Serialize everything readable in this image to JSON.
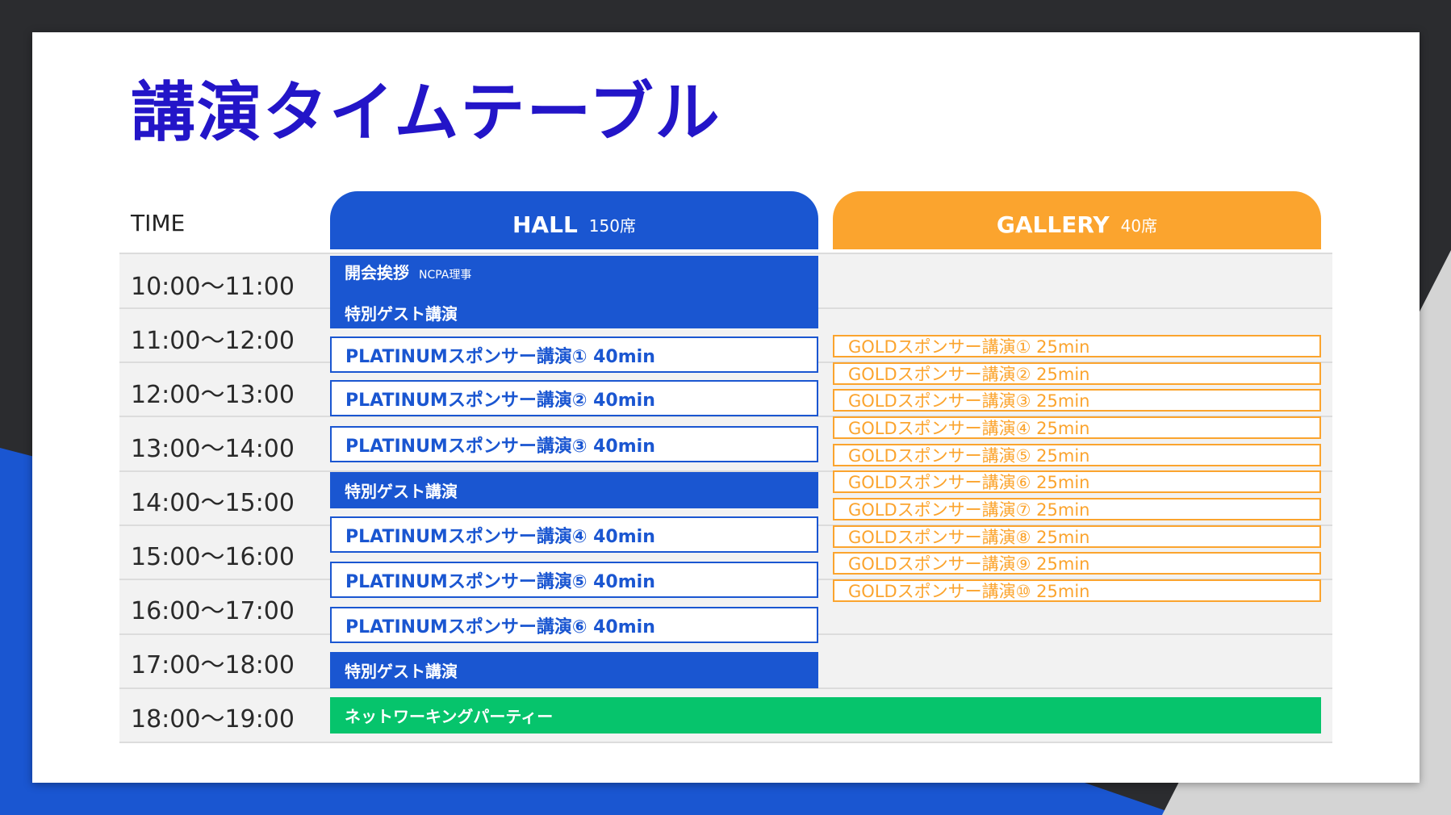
{
  "title": "講演タイムテーブル",
  "time_header": "TIME",
  "hall": {
    "name": "HALL",
    "seats": "150席"
  },
  "gallery": {
    "name": "GALLERY",
    "seats": "40席"
  },
  "time_slots": [
    "10:00〜11:00",
    "11:00〜12:00",
    "12:00〜13:00",
    "13:00〜14:00",
    "14:00〜15:00",
    "15:00〜16:00",
    "16:00〜17:00",
    "17:00〜18:00",
    "18:00〜19:00"
  ],
  "hall_sessions": {
    "opening": {
      "title": "開会挨拶",
      "sub": "NCPA理事",
      "guest": "特別ゲスト講演"
    },
    "platinum": [
      "PLATINUMスポンサー講演① 40min",
      "PLATINUMスポンサー講演② 40min",
      "PLATINUMスポンサー講演③ 40min",
      "PLATINUMスポンサー講演④ 40min",
      "PLATINUMスポンサー講演⑤ 40min",
      "PLATINUMスポンサー講演⑥ 40min"
    ],
    "guest_2": "特別ゲスト講演",
    "guest_3": "特別ゲスト講演"
  },
  "gallery_sessions": [
    "GOLDスポンサー講演① 25min",
    "GOLDスポンサー講演② 25min",
    "GOLDスポンサー講演③ 25min",
    "GOLDスポンサー講演④ 25min",
    "GOLDスポンサー講演⑤ 25min",
    "GOLDスポンサー講演⑥ 25min",
    "GOLDスポンサー講演⑦ 25min",
    "GOLDスポンサー講演⑧ 25min",
    "GOLDスポンサー講演⑨ 25min",
    "GOLDスポンサー講演⑩ 25min"
  ],
  "networking": "ネットワーキングパーティー",
  "colors": {
    "title": "#2315c8",
    "hall": "#1a56d1",
    "gallery": "#fba42e",
    "networking": "#06c46c"
  }
}
